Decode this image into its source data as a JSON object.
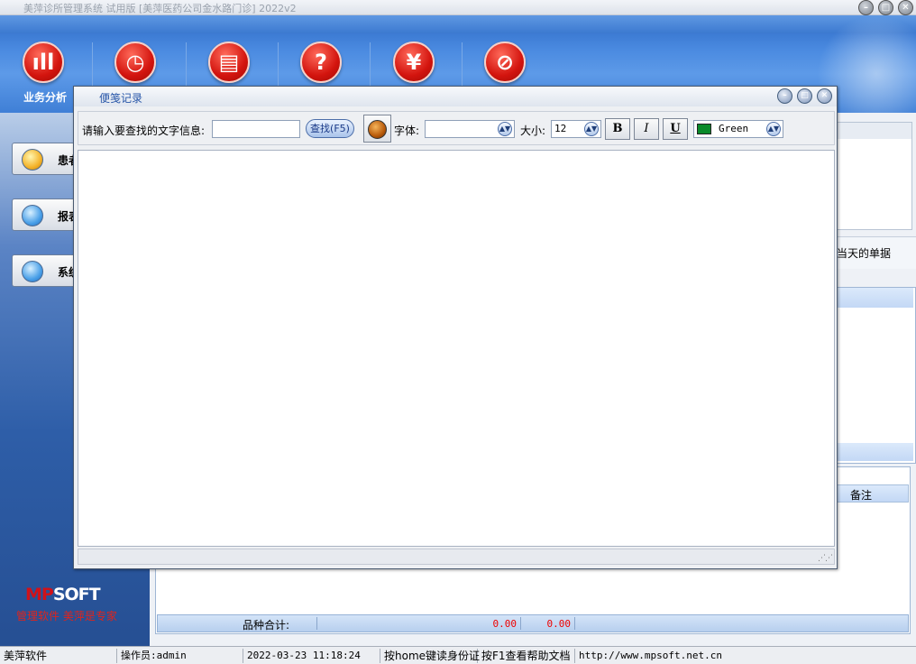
{
  "window": {
    "title": "美萍诊所管理系统 试用版 [美萍医药公司金水路门诊] 2022v2",
    "controls": [
      "minimize",
      "restore",
      "close"
    ]
  },
  "toolbar": {
    "buttons": [
      {
        "icon": "bar-chart-icon",
        "glyph": "ıll",
        "label": "业务分析"
      },
      {
        "icon": "clock-icon",
        "glyph": "◷",
        "label": ""
      },
      {
        "icon": "document-icon",
        "glyph": "▤",
        "label": ""
      },
      {
        "icon": "help-icon",
        "glyph": "?",
        "label": ""
      },
      {
        "icon": "yen-icon",
        "glyph": "¥",
        "label": ""
      },
      {
        "icon": "forbidden-icon",
        "glyph": "⊘",
        "label": ""
      }
    ]
  },
  "sidebar": {
    "items": [
      {
        "label": "患者",
        "ball": "orange"
      },
      {
        "label": "报表",
        "ball": "blue"
      },
      {
        "label": "系统",
        "ball": "blue"
      }
    ],
    "logo_mp": "MP",
    "logo_soft": "SOFT",
    "slogan": "管理软件  美萍是专家"
  },
  "main": {
    "tab_label": "当天的单据",
    "lower_header": "备注",
    "summary_label": "品种合计:",
    "summary_value1": "0.00",
    "summary_value2": "0.00"
  },
  "dialog": {
    "title": "便笺记录",
    "search_label": "请输入要查找的文字信息:",
    "search_value": "",
    "find_button": "查找(F5)",
    "font_label": "字体:",
    "font_value": "",
    "size_label": "大小:",
    "size_value": "12",
    "bold_label": "B",
    "italic_label": "I",
    "underline_label": "U",
    "color_value": "Green",
    "color_swatch": "#0a8a2a"
  },
  "statusbar": {
    "app": "美萍软件",
    "operator": "操作员:admin",
    "datetime": "2022-03-23 11:18:24",
    "hint_id": "按home键读身份证",
    "hint_help": "按F1查看帮助文档",
    "url": "http://www.mpsoft.net.cn"
  }
}
